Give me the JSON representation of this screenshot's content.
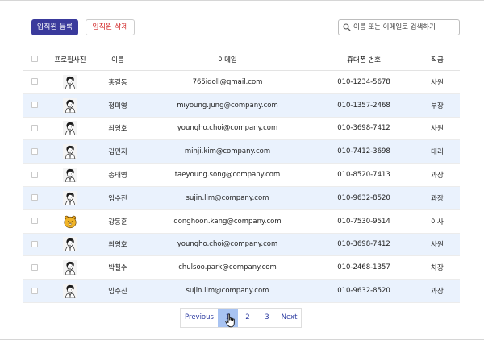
{
  "toolbar": {
    "register_label": "임직원 등록",
    "delete_label": "임직원 삭제",
    "search_placeholder": "이름 또는 이메일로 검색하기",
    "search_value": ""
  },
  "table": {
    "headers": [
      "",
      "프로필사진",
      "이름",
      "이메일",
      "휴대폰 번호",
      "직급"
    ],
    "rows": [
      {
        "name": "홍길동",
        "email": "765idoll@gmail.com",
        "phone": "010-1234-5678",
        "rank": "사원",
        "avatar": "man-avatar-icon"
      },
      {
        "name": "정미영",
        "email": "miyoung.jung@company.com",
        "phone": "010-1357-2468",
        "rank": "부장",
        "avatar": "man-avatar-icon"
      },
      {
        "name": "최영호",
        "email": "youngho.choi@company.com",
        "phone": "010-3698-7412",
        "rank": "사원",
        "avatar": "man-avatar-icon"
      },
      {
        "name": "김민지",
        "email": "minji.kim@company.com",
        "phone": "010-7412-3698",
        "rank": "대리",
        "avatar": "man-avatar-icon"
      },
      {
        "name": "송태영",
        "email": "taeyoung.song@company.com",
        "phone": "010-8520-7413",
        "rank": "과장",
        "avatar": "man-avatar-icon"
      },
      {
        "name": "임수진",
        "email": "sujin.lim@company.com",
        "phone": "010-9632-8520",
        "rank": "과장",
        "avatar": "man-avatar-icon"
      },
      {
        "name": "강동훈",
        "email": "donghoon.kang@company.com",
        "phone": "010-7530-9514",
        "rank": "이사",
        "avatar": "bear-avatar-icon"
      },
      {
        "name": "최영호",
        "email": "youngho.choi@company.com",
        "phone": "010-3698-7412",
        "rank": "사원",
        "avatar": "man-avatar-icon"
      },
      {
        "name": "박철수",
        "email": "chulsoo.park@company.com",
        "phone": "010-2468-1357",
        "rank": "차장",
        "avatar": "man-avatar-icon"
      },
      {
        "name": "임수진",
        "email": "sujin.lim@company.com",
        "phone": "010-9632-8520",
        "rank": "과장",
        "avatar": "man-avatar-icon"
      }
    ]
  },
  "pagination": {
    "previous": "Previous",
    "pages": [
      "1",
      "2",
      "3"
    ],
    "current": "1",
    "next": "Next"
  },
  "colors": {
    "primary": "#3a3a9c",
    "danger": "#d22a2a",
    "row_alt": "#eaf2fd",
    "page_active": "#a8c3f2",
    "link": "#2b3aa0"
  }
}
